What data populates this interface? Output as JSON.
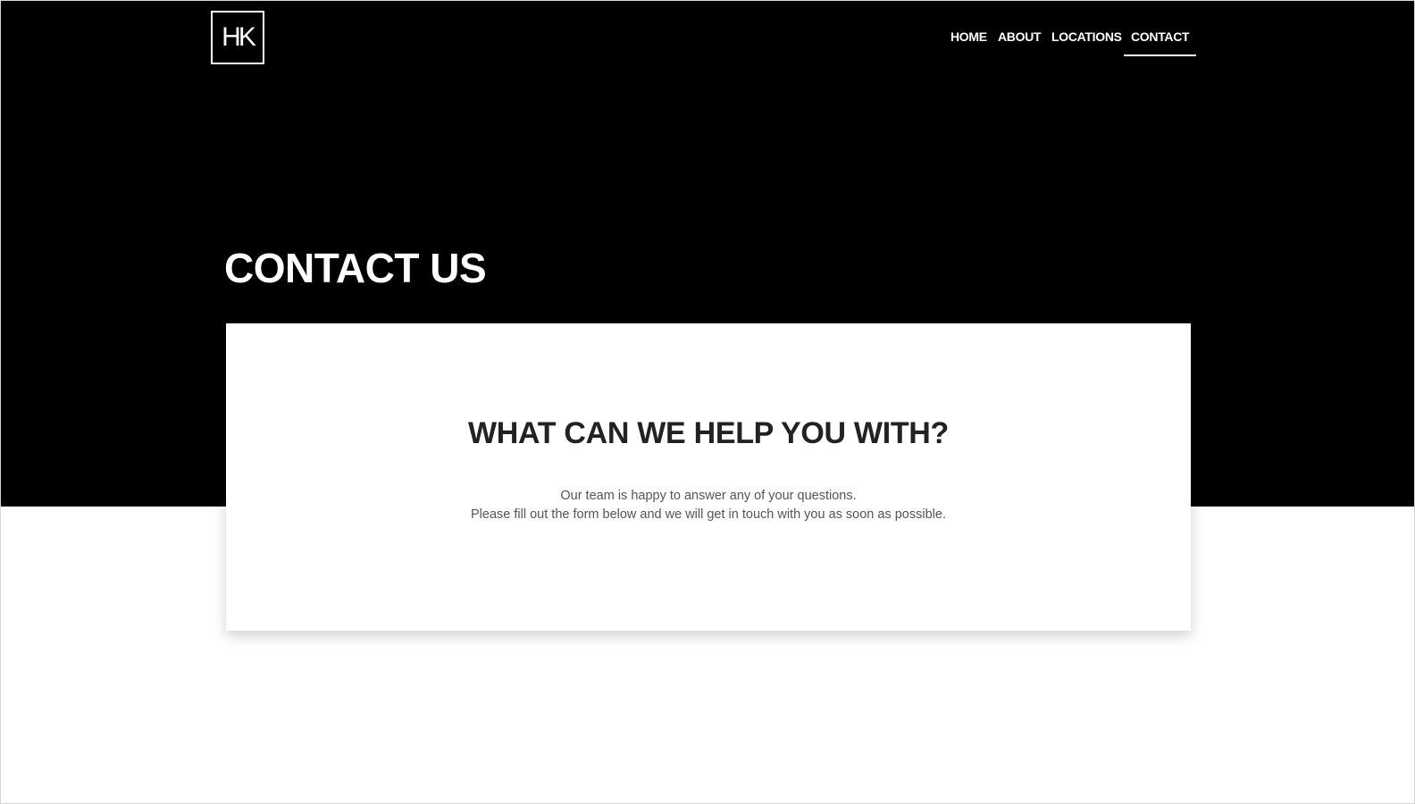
{
  "brand": {
    "logo_text": "HK"
  },
  "nav": {
    "items": [
      {
        "label": "HOME"
      },
      {
        "label": "ABOUT"
      },
      {
        "label": "LOCATIONS"
      },
      {
        "label": "CONTACT",
        "active": true
      }
    ]
  },
  "hero": {
    "title": "CONTACT US"
  },
  "card": {
    "heading": "WHAT CAN WE HELP YOU WITH?",
    "line1": "Our team is happy to answer any of your questions.",
    "line2": "Please fill out the form below and we will get in touch with you as soon as possible."
  },
  "colors": {
    "hero_bg": "#000000",
    "page_bg": "#ffffff",
    "heading_text": "#222222",
    "body_text": "#555555"
  }
}
